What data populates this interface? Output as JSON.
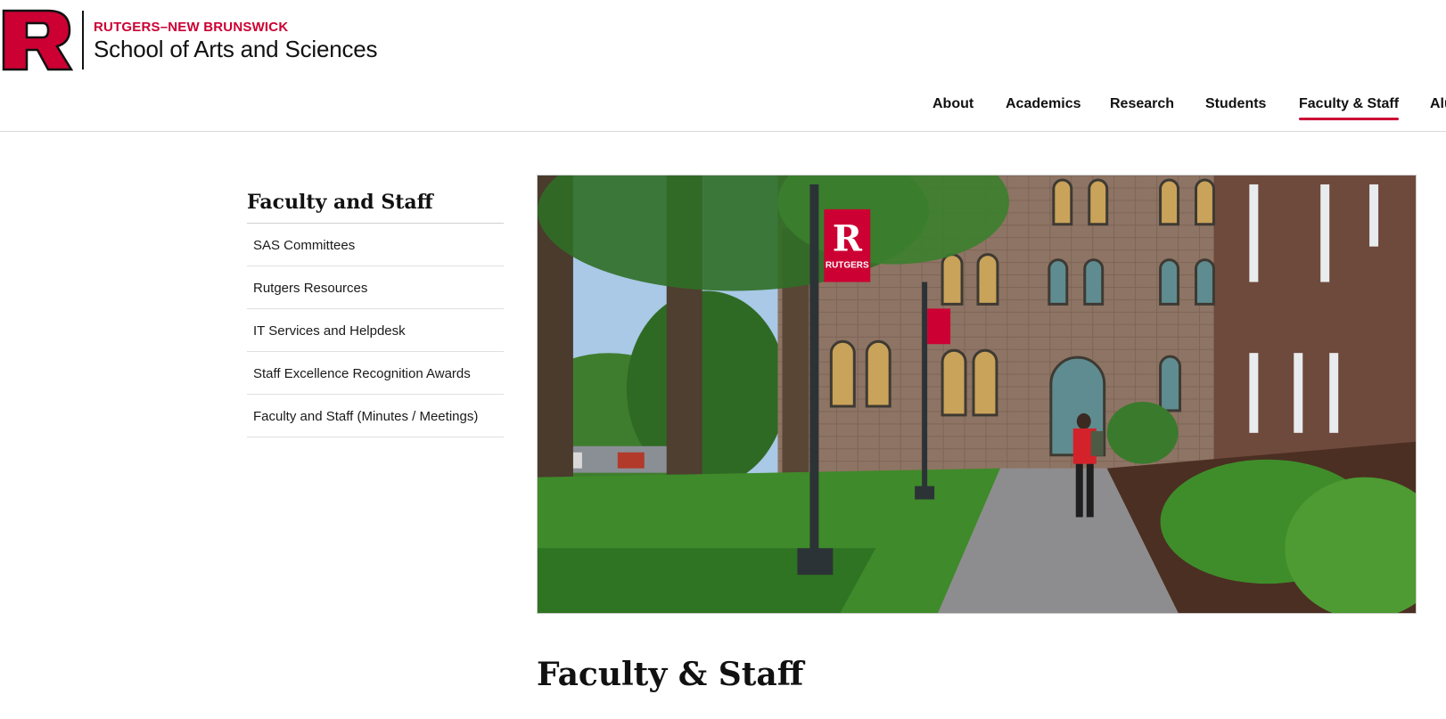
{
  "header": {
    "logo_letter": "R",
    "brand_top": "RUTGERS–NEW BRUNSWICK",
    "brand_main": "School of Arts and Sciences"
  },
  "nav": {
    "items": [
      {
        "label": "About"
      },
      {
        "label": "Academics"
      },
      {
        "label": "Research"
      },
      {
        "label": "Students"
      },
      {
        "label": "Faculty & Staff",
        "active": true
      },
      {
        "label": "Alu"
      }
    ]
  },
  "sidebar": {
    "title": "Faculty and Staff",
    "items": [
      {
        "label": "SAS Committees"
      },
      {
        "label": "Rutgers Resources"
      },
      {
        "label": "IT Services and Helpdesk"
      },
      {
        "label": "Staff Excellence Recognition Awards"
      },
      {
        "label": "Faculty and Staff (Minutes / Meetings)"
      }
    ]
  },
  "hero": {
    "banner_letter": "R",
    "banner_text": "RUTGERS"
  },
  "page": {
    "title": "Faculty & Staff"
  },
  "colors": {
    "brand": "#cc0033",
    "text": "#111111"
  }
}
